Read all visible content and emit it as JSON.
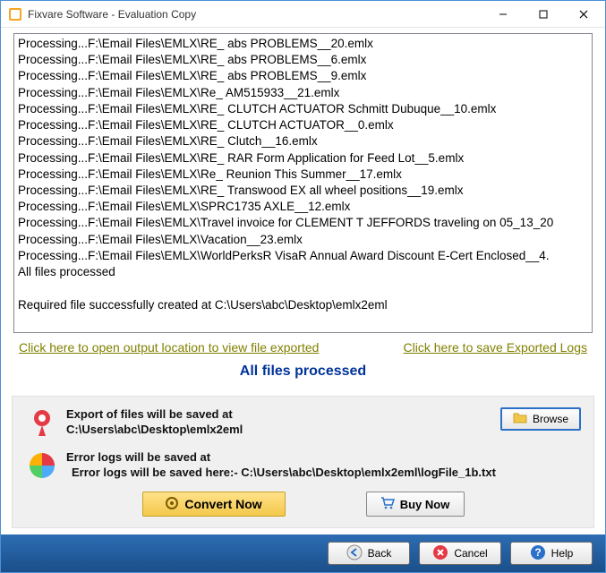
{
  "window": {
    "title": "Fixvare Software - Evaluation Copy"
  },
  "log": {
    "lines": [
      "Processing...F:\\Email Files\\EMLX\\RE_ abs PROBLEMS__20.emlx",
      "Processing...F:\\Email Files\\EMLX\\RE_ abs PROBLEMS__6.emlx",
      "Processing...F:\\Email Files\\EMLX\\RE_ abs PROBLEMS__9.emlx",
      "Processing...F:\\Email Files\\EMLX\\Re_ AM515933__21.emlx",
      "Processing...F:\\Email Files\\EMLX\\RE_ CLUTCH ACTUATOR Schmitt Dubuque__10.emlx",
      "Processing...F:\\Email Files\\EMLX\\RE_ CLUTCH ACTUATOR__0.emlx",
      "Processing...F:\\Email Files\\EMLX\\RE_ Clutch__16.emlx",
      "Processing...F:\\Email Files\\EMLX\\RE_ RAR Form Application for Feed Lot__5.emlx",
      "Processing...F:\\Email Files\\EMLX\\Re_ Reunion This Summer__17.emlx",
      "Processing...F:\\Email Files\\EMLX\\RE_ Transwood EX all wheel positions__19.emlx",
      "Processing...F:\\Email Files\\EMLX\\SPRC1735 AXLE__12.emlx",
      "Processing...F:\\Email Files\\EMLX\\Travel invoice for CLEMENT T JEFFORDS traveling on 05_13_20",
      "Processing...F:\\Email Files\\EMLX\\Vacation__23.emlx",
      "Processing...F:\\Email Files\\EMLX\\WorldPerksR VisaR Annual Award Discount E-Cert Enclosed__4.",
      "All files processed",
      "",
      "Required file successfully created at C:\\Users\\abc\\Desktop\\emlx2eml"
    ]
  },
  "links": {
    "open_output": "Click here to open output location to view file exported",
    "save_logs": "Click here to save Exported Logs"
  },
  "status": "All files processed",
  "export": {
    "label": "Export of files will be saved at",
    "path": "C:\\Users\\abc\\Desktop\\emlx2eml",
    "browse": "Browse"
  },
  "errorlog": {
    "label": "Error logs will be saved at",
    "path": "Error logs will be saved here:- C:\\Users\\abc\\Desktop\\emlx2eml\\logFile_1b.txt"
  },
  "buttons": {
    "convert": "Convert Now",
    "buy": "Buy Now",
    "back": "Back",
    "cancel": "Cancel",
    "help": "Help"
  }
}
